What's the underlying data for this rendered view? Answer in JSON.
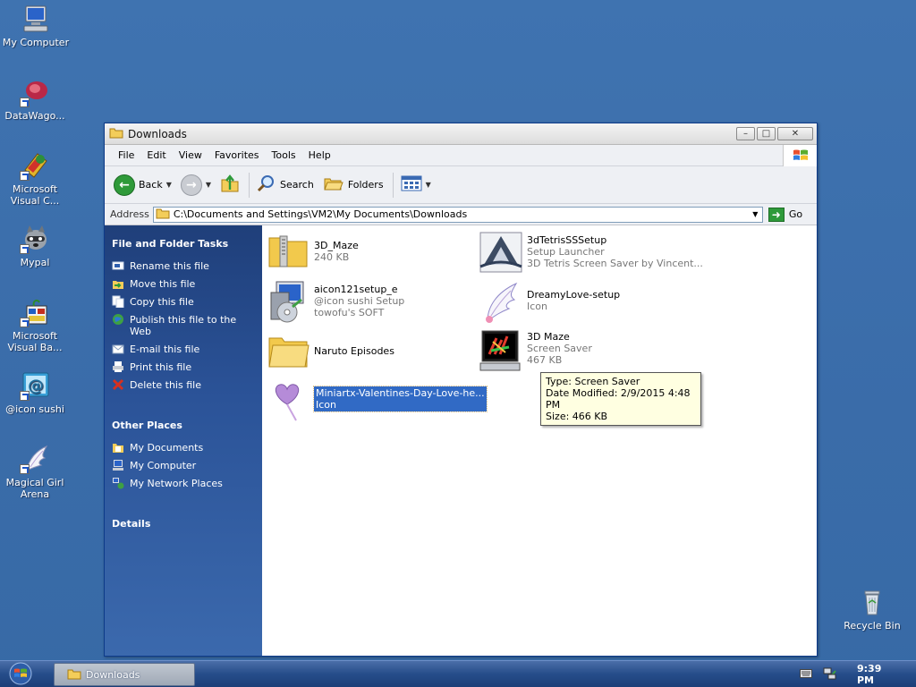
{
  "desktop": {
    "icons": [
      {
        "label": "My Computer"
      },
      {
        "label": "DataWago..."
      },
      {
        "label": "Microsoft Visual C..."
      },
      {
        "label": "Mypal"
      },
      {
        "label": "Microsoft Visual Ba..."
      },
      {
        "label": "@icon sushi"
      },
      {
        "label": "Magical Girl Arena"
      },
      {
        "label": "Recycle Bin"
      }
    ]
  },
  "window": {
    "title": "Downloads",
    "menu": [
      "File",
      "Edit",
      "View",
      "Favorites",
      "Tools",
      "Help"
    ],
    "toolbar": {
      "back": "Back",
      "search": "Search",
      "folders": "Folders"
    },
    "address": {
      "label": "Address",
      "value": "C:\\Documents and Settings\\VM2\\My Documents\\Downloads",
      "go": "Go"
    },
    "taskpane": {
      "file_tasks": {
        "title": "File and Folder Tasks",
        "items": [
          {
            "label": "Rename this file"
          },
          {
            "label": "Move this file"
          },
          {
            "label": "Copy this file"
          },
          {
            "label": "Publish this file to the Web"
          },
          {
            "label": "E-mail this file"
          },
          {
            "label": "Print this file"
          },
          {
            "label": "Delete this file"
          }
        ]
      },
      "other_places": {
        "title": "Other Places",
        "items": [
          {
            "label": "My Documents"
          },
          {
            "label": "My Computer"
          },
          {
            "label": "My Network Places"
          }
        ]
      },
      "details": {
        "title": "Details"
      }
    },
    "files": [
      {
        "name": "3D_Maze",
        "line1": "240 KB",
        "line2": ""
      },
      {
        "name": "3dTetrisSSSetup",
        "line1": "Setup Launcher",
        "line2": "3D Tetris Screen Saver by Vincent..."
      },
      {
        "name": "aicon121setup_e",
        "line1": "@icon sushi Setup",
        "line2": "towofu's SOFT"
      },
      {
        "name": "DreamyLove-setup",
        "line1": "Icon",
        "line2": ""
      },
      {
        "name": "Naruto Episodes",
        "line1": "",
        "line2": ""
      },
      {
        "name": "3D Maze",
        "line1": "Screen Saver",
        "line2": "467 KB"
      },
      {
        "name": "Miniartx-Valentines-Day-Love-he...",
        "line1": "Icon",
        "line2": ""
      }
    ],
    "tooltip": {
      "type": "Type: Screen Saver",
      "modified": "Date Modified: 2/9/2015 4:48 PM",
      "size": "Size: 466 KB"
    }
  },
  "taskbar": {
    "task_label": "Downloads",
    "clock": "9:39 PM"
  },
  "colors": {
    "desktop": "#3a6ea5",
    "taskpane": "#2b5398",
    "selection": "#316ac5",
    "tooltip_bg": "#ffffe1"
  }
}
